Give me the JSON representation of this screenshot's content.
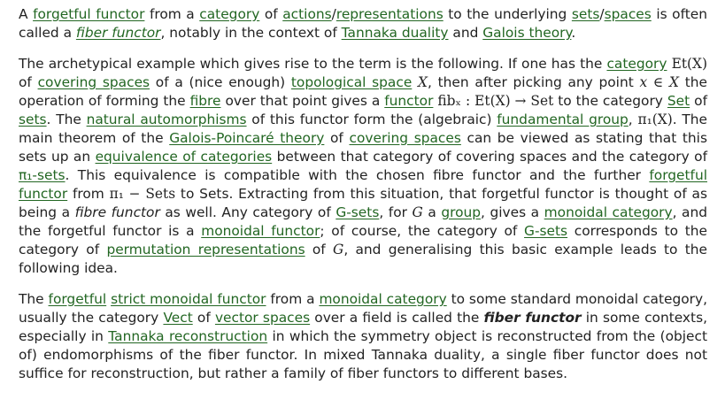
{
  "p1": {
    "t0": "A ",
    "l_forgetful_functor": "forgetful functor",
    "t1": " from a ",
    "l_category": "category",
    "t2": " of ",
    "l_actions": "actions",
    "t3": "/",
    "l_representations": "representations",
    "t4": " to the underlying ",
    "l_sets": "sets",
    "t5": "/",
    "l_spaces": "spaces",
    "t6": " is often called a ",
    "l_fiber_functor": "fiber functor",
    "t7": ", notably in the context of ",
    "l_tannaka_duality": "Tannaka duality",
    "t8": " and ",
    "l_galois_theory": "Galois theory",
    "t9": "."
  },
  "p2": {
    "t0": "The archetypical example which gives rise to the term is the following. If one has the ",
    "l_category": "category",
    "m_etx": "Et(X)",
    "t1": " of ",
    "l_covering_spaces": "covering spaces",
    "t2": " of a (nice enough) ",
    "l_topological_space": "topological space",
    "m_x1": "X",
    "t3": ", then after picking any point ",
    "m_xinx": "x ∈ X",
    "t4": " the operation of forming the ",
    "l_fibre": "fibre",
    "t5": " over that point gives a ",
    "l_functor": "functor",
    "m_fib": "fibₓ : Et(X) → Set",
    "t6": " to the category ",
    "l_set": "Set",
    "t7": " of ",
    "l_sets": "sets",
    "t8": ". The ",
    "l_natural_automorphisms": "natural automorphisms",
    "t9": " of this functor form the (algebraic) ",
    "l_fundamental_group": "fundamental group",
    "t10": ", ",
    "m_pi1x": "π₁(X)",
    "t11": ". The main theorem of the ",
    "l_galois_poincare": "Galois-Poincaré theory",
    "t12": " of ",
    "l_covering_spaces_2": "covering spaces",
    "t13": " can be viewed as stating that this sets up an ",
    "l_equivalence": "equivalence of categories",
    "t14": " between that category of covering spaces and the category of ",
    "l_pi1_sets": "π₁-sets",
    "t15": ". This equivalence is compatible with the chosen fibre functor and the further ",
    "l_forgetful_functor": "forgetful functor",
    "t16": " from ",
    "m_pi1sets": "π₁ − Sets",
    "t17": " to Sets. Extracting from this situation, that forgetful functor is thought of as being a ",
    "i_fibre_functor": "fibre functor",
    "t18": " as well. Any category of ",
    "l_g_sets": "G-sets",
    "t19": ", for ",
    "m_g1": "G",
    "t20": " a ",
    "l_group": "group",
    "t21": ", gives a ",
    "l_monoidal_category": "monoidal category",
    "t22": ", and the forgetful functor is a ",
    "l_monoidal_functor": "monoidal functor",
    "t23": "; of course, the category of ",
    "l_g_sets_2": "G-sets",
    "t24": " corresponds to the category of ",
    "l_permutation_reps": "permutation representations",
    "t25": " of ",
    "m_g2": "G",
    "t26": ", and generalising this basic example leads to the following idea."
  },
  "p3": {
    "t0": "The ",
    "l_forgetful": "forgetful",
    "t1": " ",
    "l_strict_monoidal_functor": "strict monoidal functor",
    "t2": " from a ",
    "l_monoidal_category": "monoidal category",
    "t3": " to some standard monoidal category, usually the category ",
    "l_vect": "Vect",
    "t4": " of ",
    "l_vector_spaces": "vector spaces",
    "t5": " over a field is called the ",
    "b_fiber_functor": "fiber functor",
    "t6": " in some contexts, especially in ",
    "l_tannaka_reconstruction": "Tannaka reconstruction",
    "t7": " in which the symmetry object is reconstructed from the (object of) endomorphisms of the fiber functor. In mixed Tannaka duality, a single fiber functor does not suffice for reconstruction, but rather a family of fiber functors to different bases."
  }
}
